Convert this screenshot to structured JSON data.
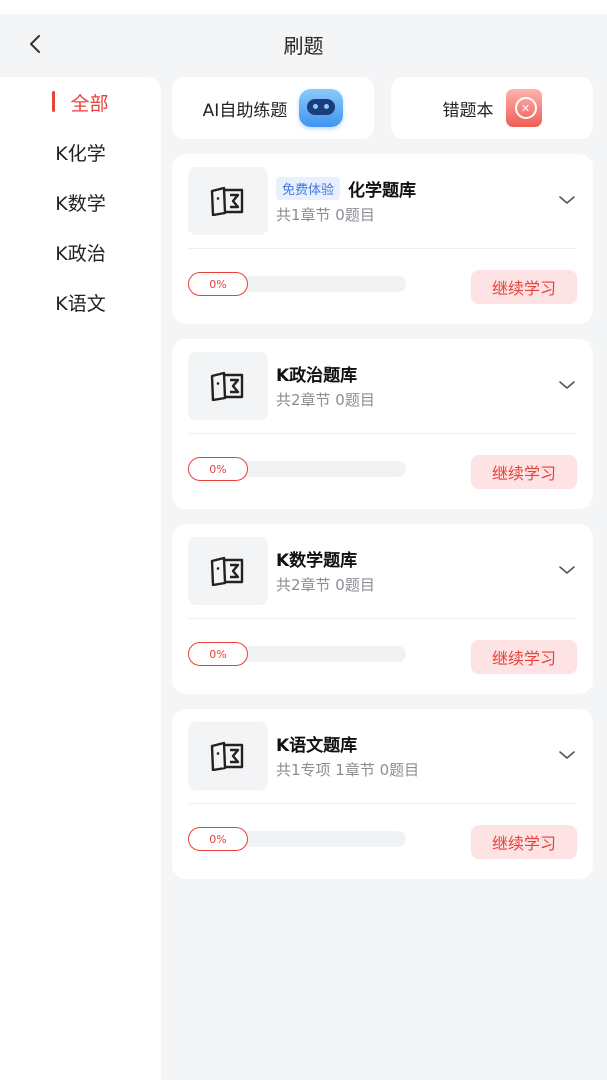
{
  "header": {
    "title": "刷题"
  },
  "sidebar": {
    "items": [
      {
        "label": "全部",
        "active": true
      },
      {
        "label": "K化学"
      },
      {
        "label": "K数学"
      },
      {
        "label": "K政治"
      },
      {
        "label": "K语文"
      }
    ]
  },
  "tools": {
    "ai_label": "AI自助练题",
    "wrong_label": "错题本"
  },
  "cards": [
    {
      "badge": "免费体验",
      "name": "化学题库",
      "meta": "共1章节 0题目",
      "progress": "0%",
      "action": "继续学习"
    },
    {
      "name": "K政治题库",
      "meta": "共2章节 0题目",
      "progress": "0%",
      "action": "继续学习"
    },
    {
      "name": "K数学题库",
      "meta": "共2章节 0题目",
      "progress": "0%",
      "action": "继续学习"
    },
    {
      "name": "K语文题库",
      "meta": "共1专项 1章节 0题目",
      "progress": "0%",
      "action": "继续学习"
    }
  ],
  "colors": {
    "accent": "#e8413a",
    "badge": "#3f78e0"
  }
}
